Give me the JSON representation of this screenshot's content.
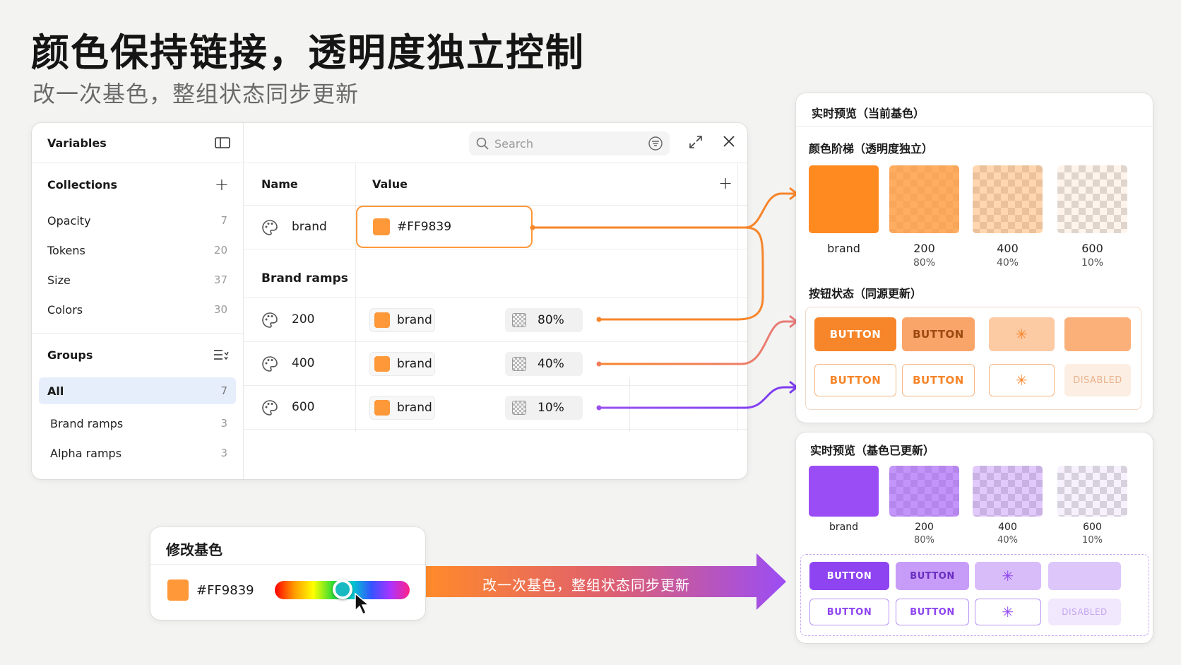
{
  "title": "颜色保持链接，透明度独立控制",
  "subtitle": "改一次基色，整组状态同步更新",
  "variables": {
    "panel_title": "Variables",
    "collections_label": "Collections",
    "collections": [
      {
        "label": "Opacity",
        "count": "7"
      },
      {
        "label": "Tokens",
        "count": "20"
      },
      {
        "label": "Size",
        "count": "37"
      },
      {
        "label": "Colors",
        "count": "30"
      }
    ],
    "groups_label": "Groups",
    "groups_all": {
      "label": "All",
      "count": "7"
    },
    "groups": [
      {
        "label": "Brand ramps",
        "count": "3"
      },
      {
        "label": "Alpha ramps",
        "count": "3"
      }
    ],
    "search_placeholder": "Search",
    "col_name": "Name",
    "col_value": "Value",
    "brand_row": {
      "name": "brand",
      "value": "#FF9839"
    },
    "group_title": "Brand ramps",
    "ramp_rows": [
      {
        "name": "200",
        "ref": "brand",
        "alpha": "80%"
      },
      {
        "name": "400",
        "ref": "brand",
        "alpha": "40%"
      },
      {
        "name": "600",
        "ref": "brand",
        "alpha": "10%"
      }
    ]
  },
  "preview_current": {
    "title": "实时预览（当前基色）",
    "ramp_title": "颜色阶梯（透明度独立）",
    "tiles": [
      {
        "label": "brand",
        "pct": ""
      },
      {
        "label": "200",
        "pct": "80%"
      },
      {
        "label": "400",
        "pct": "40%"
      },
      {
        "label": "600",
        "pct": "10%"
      }
    ],
    "button_title": "按钮状态（同源更新）",
    "button_label": "BUTTON",
    "disabled_label": "DISABLED"
  },
  "preview_updated": {
    "title": "实时预览（基色已更新）",
    "tiles": [
      {
        "label": "brand",
        "pct": ""
      },
      {
        "label": "200",
        "pct": "80%"
      },
      {
        "label": "400",
        "pct": "40%"
      },
      {
        "label": "600",
        "pct": "10%"
      }
    ],
    "button_label": "BUTTON",
    "disabled_label": "DISABLED"
  },
  "base_color": {
    "title": "修改基色",
    "value": "#FF9839",
    "hue_position": 0.5
  },
  "arrow_text": "改一次基色，整组状态同步更新",
  "colors": {
    "brand": "#FF9839",
    "brand_updated": "#9B4DF5",
    "accent_orange": "#F7852A",
    "accent_purple": "#8E44F0"
  }
}
